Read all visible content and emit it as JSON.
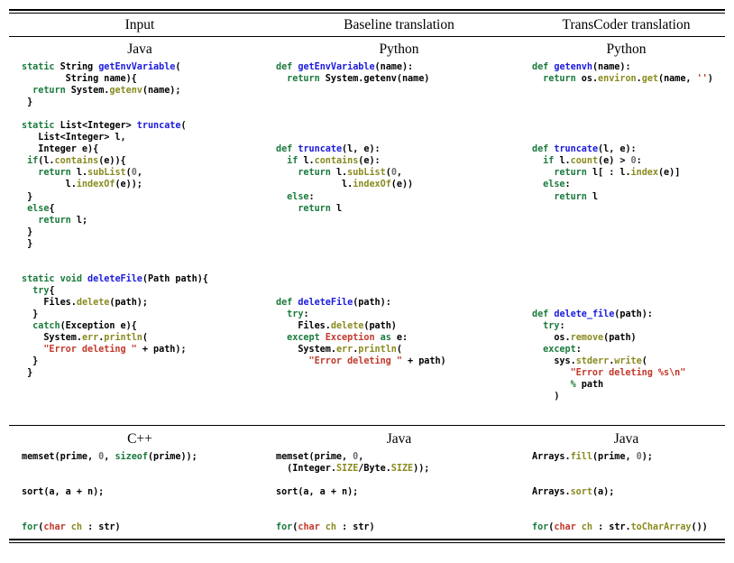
{
  "table": {
    "headers": [
      {
        "label": "Input"
      },
      {
        "label": "Baseline translation"
      },
      {
        "label": "TransCoder translation"
      }
    ],
    "sections": [
      {
        "name": "functions-section",
        "columns": [
          {
            "language": "Java",
            "snippets": [
              "static String getEnvVariable(\n        String name){\n  return System.getenv(name);\n }",
              "static List<Integer> truncate(\n   List<Integer> l,\n   Integer e){\n if(l.contains(e)){\n   return l.subList(0,\n        l.indexOf(e));\n }\n else{\n   return l;\n }\n }",
              "static void deleteFile(Path path){\n  try{\n    Files.delete(path);\n  }\n  catch(Exception e){\n    System.err.println(\n    \"Error deleting \" + path);\n  }\n }"
            ]
          },
          {
            "language": "Python",
            "snippets": [
              "def getEnvVariable(name):\n  return System.getenv(name)",
              "def truncate(l, e):\n  if l.contains(e):\n    return l.subList(0,\n            l.indexOf(e))\n  else:\n    return l",
              "def deleteFile(path):\n  try:\n    Files.delete(path)\n  except Exception as e:\n    System.err.println(\n      \"Error deleting \" + path)"
            ]
          },
          {
            "language": "Python",
            "snippets": [
              "def getenvh(name):\n  return os.environ.get(name, '')",
              "def truncate(l, e):\n  if l.count(e) > 0:\n    return l[ : l.index(e)]\n  else:\n    return l",
              "def delete_file(path):\n  try:\n    os.remove(path)\n  except:\n    sys.stderr.write(\n       \"Error deleting %s\\n\"\n       % path\n    )"
            ]
          }
        ]
      },
      {
        "name": "statements-section",
        "columns": [
          {
            "language": "C++",
            "snippets": [
              "memset(prime, 0, sizeof(prime));",
              "sort(a, a + n);",
              "for(char ch : str)"
            ]
          },
          {
            "language": "Java",
            "snippets": [
              "memset(prime, 0,\n  (Integer.SIZE/Byte.SIZE));",
              "sort(a, a + n);",
              "for(char ch : str)"
            ]
          },
          {
            "language": "Java",
            "snippets": [
              "Arrays.fill(prime, 0);",
              "Arrays.sort(a);",
              "for(char ch : str.toCharArray())"
            ]
          }
        ]
      }
    ]
  },
  "colors": {
    "keyword": "#1a7a3c",
    "definition_name": "#1a1adf",
    "member": "#8a8a20",
    "string": "#c2392b",
    "number": "#707070",
    "plain": "#000000",
    "rule": "#000000",
    "background": "#ffffff"
  }
}
